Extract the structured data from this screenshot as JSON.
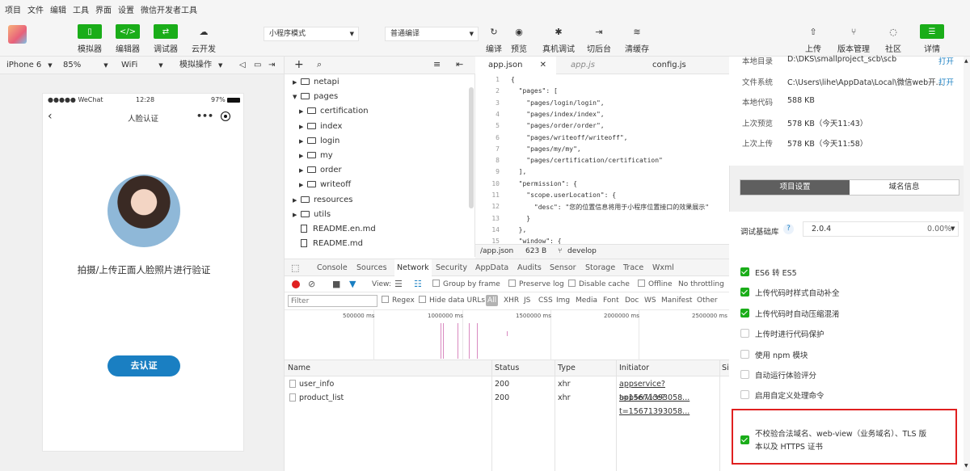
{
  "menu": [
    "项目",
    "文件",
    "编辑",
    "工具",
    "界面",
    "设置",
    "微信开发者工具"
  ],
  "toolbar": {
    "simulator": "模拟器",
    "editor": "编辑器",
    "debugger": "调试器",
    "cloud": "云开发",
    "mode_select": "小程序模式",
    "compile_select": "普通编译",
    "compile": "编译",
    "preview": "预览",
    "remote_debug": "真机调试",
    "background": "切后台",
    "clear_cache": "清缓存",
    "upload": "上传",
    "version_mgmt": "版本管理",
    "community": "社区",
    "details": "详情"
  },
  "devicebar": {
    "device": "iPhone 6",
    "zoom": "85%",
    "network": "WiFi",
    "op": "模拟操作"
  },
  "phone": {
    "carrier": "●●●●● WeChat",
    "time": "12:28",
    "battery": "97%",
    "nav_title": "人脸认证",
    "more": "•••",
    "prompt": "拍摄/上传正面人脸照片进行验证",
    "button": "去认证"
  },
  "tree": {
    "netapi": "netapi",
    "pages": "pages",
    "certification": "certification",
    "index": "index",
    "login": "login",
    "my": "my",
    "order": "order",
    "writeoff": "writeoff",
    "resources": "resources",
    "utils": "utils",
    "readme_en": "README.en.md",
    "readme": "README.md"
  },
  "editor": {
    "tab1": "app.json",
    "tab2": "app.js",
    "tab3": "config.js",
    "lines": [
      "{",
      "  \"pages\": [",
      "    \"pages/login/login\",",
      "    \"pages/index/index\",",
      "    \"pages/order/order\",",
      "    \"pages/writeoff/writeoff\",",
      "    \"pages/my/my\",",
      "    \"pages/certification/certification\"",
      "  ],",
      "  \"permission\": {",
      "    \"scope.userLocation\": {",
      "      \"desc\": \"您的位置信息将用于小程序位置接口的效果展示\"",
      "    }",
      "  },",
      "  \"window\": {"
    ],
    "line_numbers": [
      "1",
      "2",
      "3",
      "4",
      "5",
      "6",
      "7",
      "8",
      "9",
      "10",
      "11",
      "12",
      "13",
      "14",
      "15"
    ],
    "status_file": "/app.json",
    "status_size": "623 B",
    "status_branch": "develop"
  },
  "devtools": {
    "tabs": [
      "Console",
      "Sources",
      "Network",
      "Security",
      "AppData",
      "Audits",
      "Sensor",
      "Storage",
      "Trace",
      "Wxml"
    ],
    "view": "View:",
    "group_by_frame": "Group by frame",
    "preserve_log": "Preserve log",
    "disable_cache": "Disable cache",
    "offline": "Offline",
    "throttling": "No throttling",
    "filter_placeholder": "Filter",
    "regex": "Regex",
    "hide_data_urls": "Hide data URLs",
    "types": [
      "All",
      "XHR",
      "JS",
      "CSS",
      "Img",
      "Media",
      "Font",
      "Doc",
      "WS",
      "Manifest",
      "Other"
    ],
    "timeline_labels": [
      "500000 ms",
      "1000000 ms",
      "1500000 ms",
      "2000000 ms",
      "2500000 ms"
    ],
    "columns": [
      "Name",
      "Status",
      "Type",
      "Initiator",
      "Si"
    ],
    "rows": [
      {
        "name": "user_info",
        "status": "200",
        "type": "xhr",
        "initiator": "appservice?t=15671393058..."
      },
      {
        "name": "product_list",
        "status": "200",
        "type": "xhr",
        "initiator": "appservice?t=15671393058..."
      }
    ]
  },
  "panel": {
    "local_dir_label": "本地目录",
    "local_dir_value": "D:\\DKS\\smallproject_scb\\scb",
    "file_sys_label": "文件系统",
    "file_sys_value": "C:\\Users\\lihe\\AppData\\Local\\微信web开...",
    "open": "打开",
    "open2": "打开",
    "local_code_label": "本地代码",
    "local_code_value": "588 KB",
    "last_preview_label": "上次预览",
    "last_preview_value": "578 KB（今天11:43）",
    "last_upload_label": "上次上传",
    "last_upload_value": "578 KB（今天11:58）",
    "tab_project": "项目设置",
    "tab_domain": "域名信息",
    "base_lib_label": "调试基础库",
    "base_lib_help": "?",
    "base_lib_version": "2.0.4",
    "base_lib_percent": "0.00%",
    "options": [
      {
        "label": "ES6 转 ES5",
        "checked": true
      },
      {
        "label": "上传代码时样式自动补全",
        "checked": true
      },
      {
        "label": "上传代码时自动压缩混淆",
        "checked": true
      },
      {
        "label": "上传时进行代码保护",
        "checked": false
      },
      {
        "label": "使用 npm 模块",
        "checked": false
      },
      {
        "label": "自动运行体验评分",
        "checked": false
      },
      {
        "label": "启用自定义处理命令",
        "checked": false
      }
    ],
    "highlight_line1": "不校验合法域名、web-view（业务域名）、TLS 版",
    "highlight_line2": "本以及 HTTPS 证书",
    "highlight_checked": true
  },
  "colors": {
    "accent_green": "#1aad19",
    "link_blue": "#1a7fc2",
    "highlight_red": "#e02020"
  }
}
